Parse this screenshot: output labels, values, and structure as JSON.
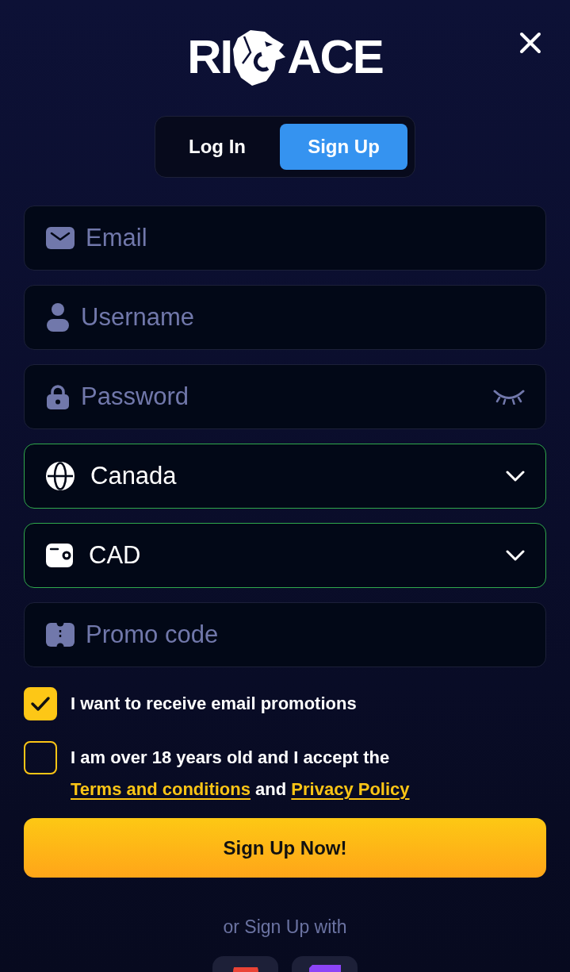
{
  "logo": {
    "left": "RI",
    "right": "ACE"
  },
  "tabs": [
    {
      "label": "Log In",
      "selected": false
    },
    {
      "label": "Sign Up",
      "selected": true
    }
  ],
  "fields": [
    {
      "kind": "email",
      "placeholder": "Email",
      "valid": false
    },
    {
      "kind": "username",
      "placeholder": "Username",
      "valid": false
    },
    {
      "kind": "password",
      "placeholder": "Password",
      "valid": false
    },
    {
      "kind": "country",
      "value": "Canada",
      "valid": true
    },
    {
      "kind": "currency",
      "value": "CAD",
      "valid": true
    },
    {
      "kind": "promo",
      "placeholder": "Promo code",
      "valid": false
    }
  ],
  "consents": [
    {
      "checked": true,
      "parts": [
        {
          "kind": "text",
          "text": "I want to receive email promotions"
        }
      ]
    },
    {
      "checked": false,
      "parts": [
        {
          "kind": "text",
          "text": "I am over 18 years old and I accept the"
        },
        {
          "kind": "link",
          "text": "Terms and conditions"
        },
        {
          "kind": "text",
          "text": "and"
        },
        {
          "kind": "link",
          "text": "Privacy Policy"
        }
      ]
    }
  ],
  "submit": "Sign Up Now!",
  "alt_signup": "or Sign Up with"
}
